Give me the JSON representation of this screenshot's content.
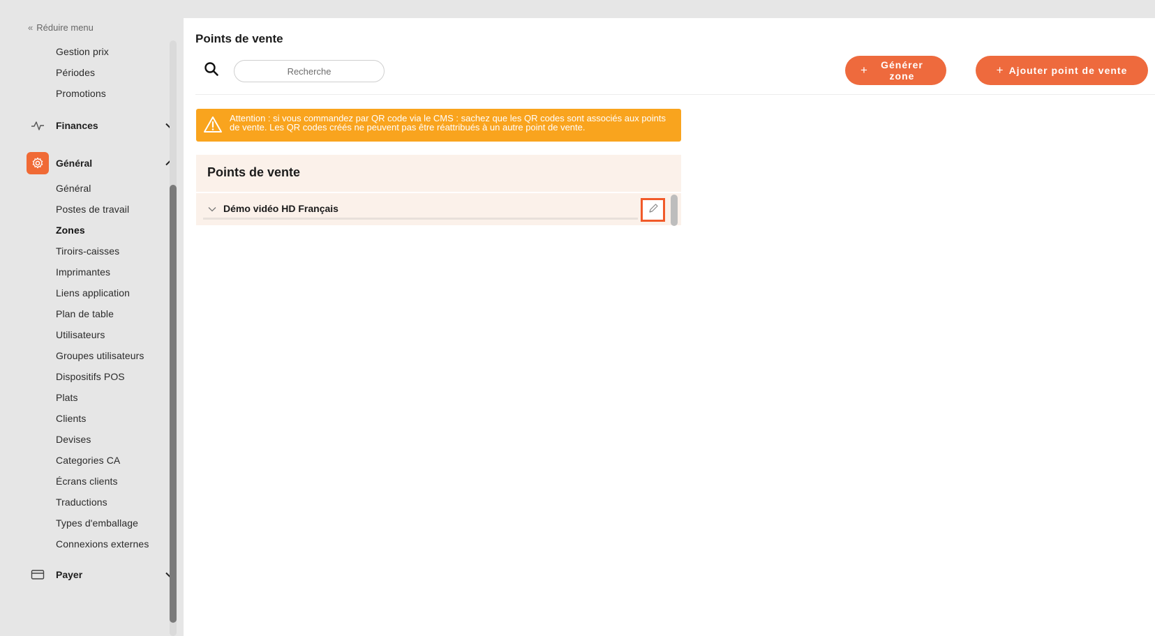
{
  "sidebar": {
    "collapse_label": "Réduire menu",
    "top_items": [
      {
        "label": "Gestion prix"
      },
      {
        "label": "Périodes"
      },
      {
        "label": "Promotions"
      }
    ],
    "sections": {
      "finances": {
        "label": "Finances",
        "icon": "activity-icon",
        "expanded": false
      },
      "general": {
        "label": "Général",
        "icon": "gear-icon",
        "expanded": true,
        "accent": "#f06a35"
      },
      "payer": {
        "label": "Payer",
        "icon": "credit-card-icon",
        "expanded": false
      }
    },
    "general_items": [
      {
        "label": "Général"
      },
      {
        "label": "Postes de travail"
      },
      {
        "label": "Zones",
        "active": true
      },
      {
        "label": "Tiroirs-caisses"
      },
      {
        "label": "Imprimantes"
      },
      {
        "label": "Liens application"
      },
      {
        "label": "Plan de table"
      },
      {
        "label": "Utilisateurs"
      },
      {
        "label": "Groupes utilisateurs"
      },
      {
        "label": "Dispositifs POS"
      },
      {
        "label": "Plats"
      },
      {
        "label": "Clients"
      },
      {
        "label": "Devises"
      },
      {
        "label": "Categories CA"
      },
      {
        "label": "Écrans clients"
      },
      {
        "label": "Traductions"
      },
      {
        "label": "Types d'emballage"
      },
      {
        "label": "Connexions externes"
      }
    ]
  },
  "header": {
    "title": "Points de vente",
    "search": {
      "placeholder": "Recherche",
      "value": ""
    },
    "buttons": {
      "generate_zone": "Générer zone",
      "add_point": "Ajouter point de vente"
    },
    "accent_color": "#ee6a3d"
  },
  "alert": {
    "text": "Attention : si vous commandez par QR code via le CMS : sachez que les QR codes sont associés aux points de vente. Les QR codes créés ne peuvent pas être réattribués à un autre point de vente.",
    "color": "#f9a41e"
  },
  "panel": {
    "title": "Points de vente",
    "rows": [
      {
        "name": "Démo vidéo HD Français"
      }
    ]
  }
}
